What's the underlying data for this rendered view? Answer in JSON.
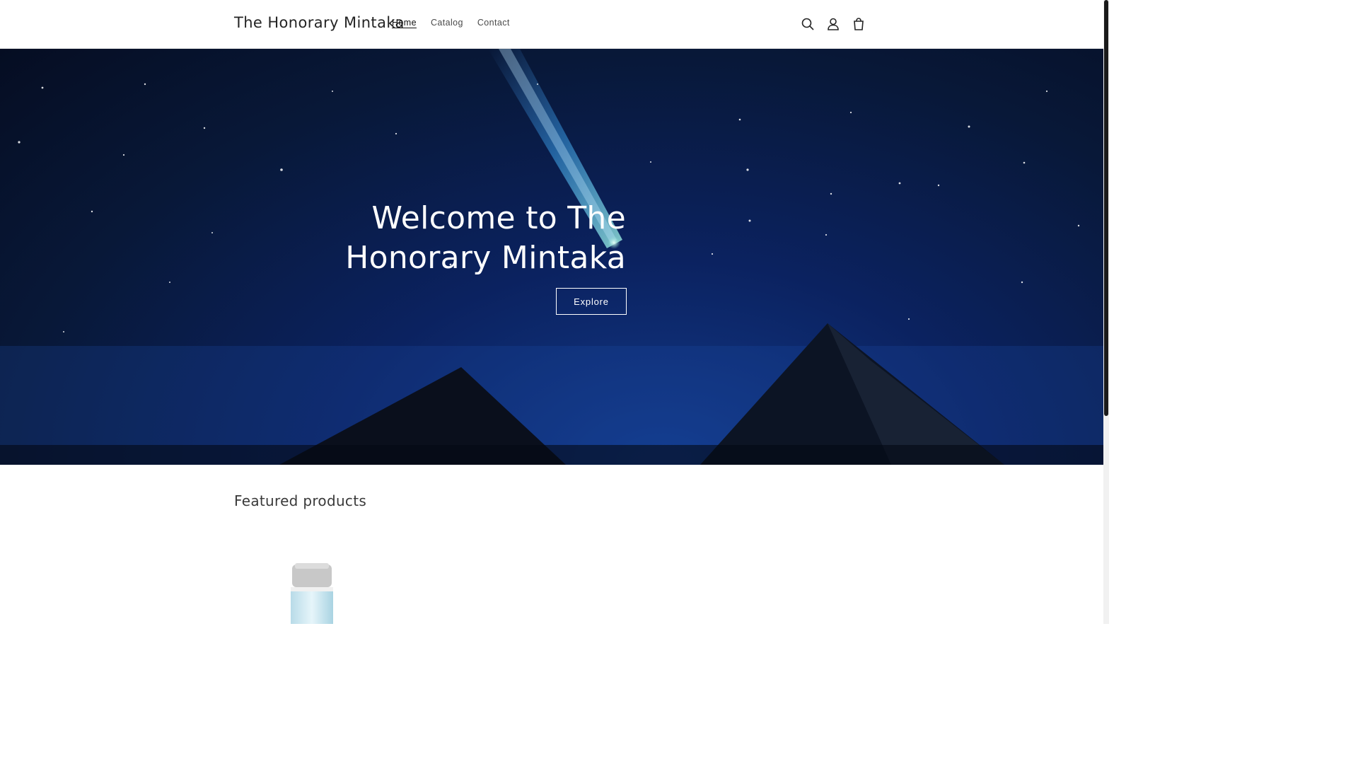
{
  "header": {
    "brand": "The Honorary Mintaka",
    "nav": [
      {
        "label": "Home",
        "active": true
      },
      {
        "label": "Catalog",
        "active": false
      },
      {
        "label": "Contact",
        "active": false
      }
    ],
    "icons": [
      "search-icon",
      "account-icon",
      "cart-icon"
    ]
  },
  "hero": {
    "title": "Welcome to The Honorary Mintaka",
    "button_label": "Explore"
  },
  "featured": {
    "title": "Featured products"
  },
  "colors": {
    "hero_sky": "#081838",
    "accent": "#121212"
  }
}
